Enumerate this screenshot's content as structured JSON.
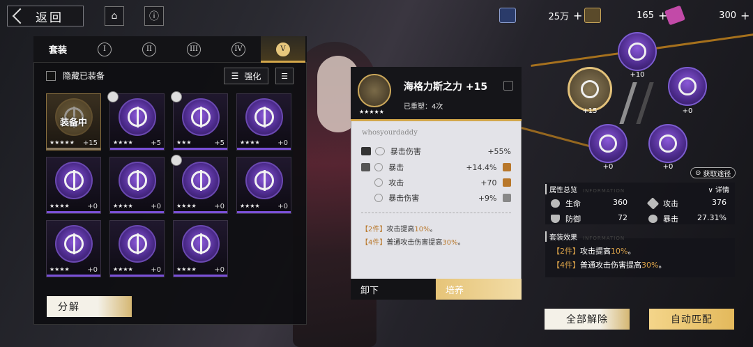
{
  "nav": {
    "back_label": "返回"
  },
  "currencies": [
    {
      "icon": "coin-ring-icon",
      "value": "25万"
    },
    {
      "icon": "fleur-emblem-icon",
      "value": "165"
    },
    {
      "icon": "ticket-icon",
      "value": "300"
    }
  ],
  "panel": {
    "tabs_label": "套装",
    "tabs": [
      "I",
      "II",
      "III",
      "IV",
      "V"
    ],
    "selected_tab": "V",
    "hide_equipped_label": "隐藏已装备",
    "enhance_label": "强化",
    "decompose_label": "分解",
    "equipped_label": "装备中",
    "cards": [
      {
        "stars": "★★★★★",
        "level": "+15",
        "equipped": true,
        "avatar": false
      },
      {
        "stars": "★★★★",
        "level": "+5",
        "equipped": false,
        "avatar": true
      },
      {
        "stars": "★★★",
        "level": "+5",
        "equipped": false,
        "avatar": true
      },
      {
        "stars": "★★★★",
        "level": "+0",
        "equipped": false,
        "avatar": false
      },
      {
        "stars": "★★★★",
        "level": "+0",
        "equipped": false,
        "avatar": false
      },
      {
        "stars": "★★★★",
        "level": "+0",
        "equipped": false,
        "avatar": false
      },
      {
        "stars": "★★★★",
        "level": "+0",
        "equipped": false,
        "avatar": true
      },
      {
        "stars": "★★★★",
        "level": "+0",
        "equipped": false,
        "avatar": false
      },
      {
        "stars": "★★★★",
        "level": "+0",
        "equipped": false,
        "avatar": false
      },
      {
        "stars": "★★★★",
        "level": "+0",
        "equipped": false,
        "avatar": false
      },
      {
        "stars": "★★★★",
        "level": "+0",
        "equipped": false,
        "avatar": false
      }
    ]
  },
  "detail": {
    "name": "海格力斯之力 +15",
    "stars": "★★★★★",
    "reforge": "已重塑：4次",
    "owner": "whosyourdaddy",
    "stats": [
      {
        "name": "暴击伤害",
        "value": "+55%"
      },
      {
        "name": "暴击",
        "value": "+14.4%"
      },
      {
        "name": "攻击",
        "value": "+70"
      },
      {
        "name": "暴击伤害",
        "value": "+9%"
      }
    ],
    "set2_key": "【2件】",
    "set2_text": "攻击提高",
    "set2_val": "10%",
    "set2_end": "。",
    "set4_key": "【4件】",
    "set4_text": "普通攻击伤害提高",
    "set4_val": "30%",
    "set4_end": "。",
    "unequip_label": "卸下",
    "train_label": "培养"
  },
  "nodes": [
    "+10",
    "+15",
    "+0",
    "+0",
    "+0"
  ],
  "right": {
    "get_path": "获取途径",
    "attr_title": "属性总览",
    "attr_ghost": "INFORMATION",
    "detail_label": "详情",
    "attrs": [
      {
        "name": "生命",
        "value": "360"
      },
      {
        "name": "攻击",
        "value": "376"
      },
      {
        "name": "防御",
        "value": "72"
      },
      {
        "name": "暴击",
        "value": "27.31%"
      }
    ],
    "set_title": "套装效果",
    "set_ghost": "INFORMATION",
    "remove_all_label": "全部解除",
    "auto_match_label": "自动匹配"
  }
}
